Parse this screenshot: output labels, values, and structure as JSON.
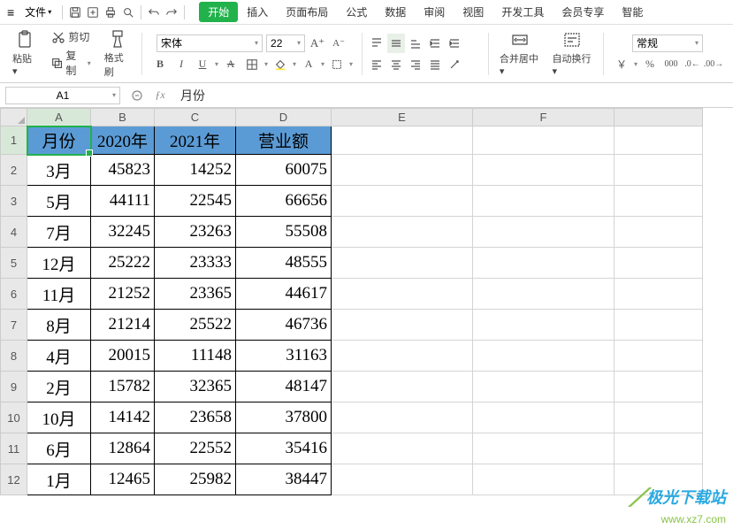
{
  "menu": {
    "file": "文件",
    "tabs": [
      "开始",
      "插入",
      "页面布局",
      "公式",
      "数据",
      "审阅",
      "视图",
      "开发工具",
      "会员专享",
      "智能"
    ]
  },
  "ribbon": {
    "cut": "剪切",
    "copy": "复制",
    "paste": "粘贴",
    "formatpainter": "格式刷",
    "fontname": "宋体",
    "fontsize": "22",
    "merge": "合并居中",
    "wrap": "自动换行",
    "numfmt": "常规"
  },
  "namebox": "A1",
  "formula": "月份",
  "sheet": {
    "cols": [
      "A",
      "B",
      "C",
      "D",
      "E",
      "F"
    ],
    "headers": [
      "月份",
      "2020年",
      "2021年",
      "营业额"
    ],
    "rows": [
      [
        "3月",
        "45823",
        "14252",
        "60075"
      ],
      [
        "5月",
        "44111",
        "22545",
        "66656"
      ],
      [
        "7月",
        "32245",
        "23263",
        "55508"
      ],
      [
        "12月",
        "25222",
        "23333",
        "48555"
      ],
      [
        "11月",
        "21252",
        "23365",
        "44617"
      ],
      [
        "8月",
        "21214",
        "25522",
        "46736"
      ],
      [
        "4月",
        "20015",
        "11148",
        "31163"
      ],
      [
        "2月",
        "15782",
        "32365",
        "48147"
      ],
      [
        "10月",
        "14142",
        "23658",
        "37800"
      ],
      [
        "6月",
        "12864",
        "22552",
        "35416"
      ],
      [
        "1月",
        "12465",
        "25982",
        "38447"
      ]
    ]
  },
  "watermark": {
    "line1": "极光下载站",
    "line2": "www.xz7.com"
  },
  "icons": {
    "bold": "B",
    "italic": "I",
    "underline": "U",
    "strike": "A",
    "yen": "￥",
    "pct": "%"
  }
}
